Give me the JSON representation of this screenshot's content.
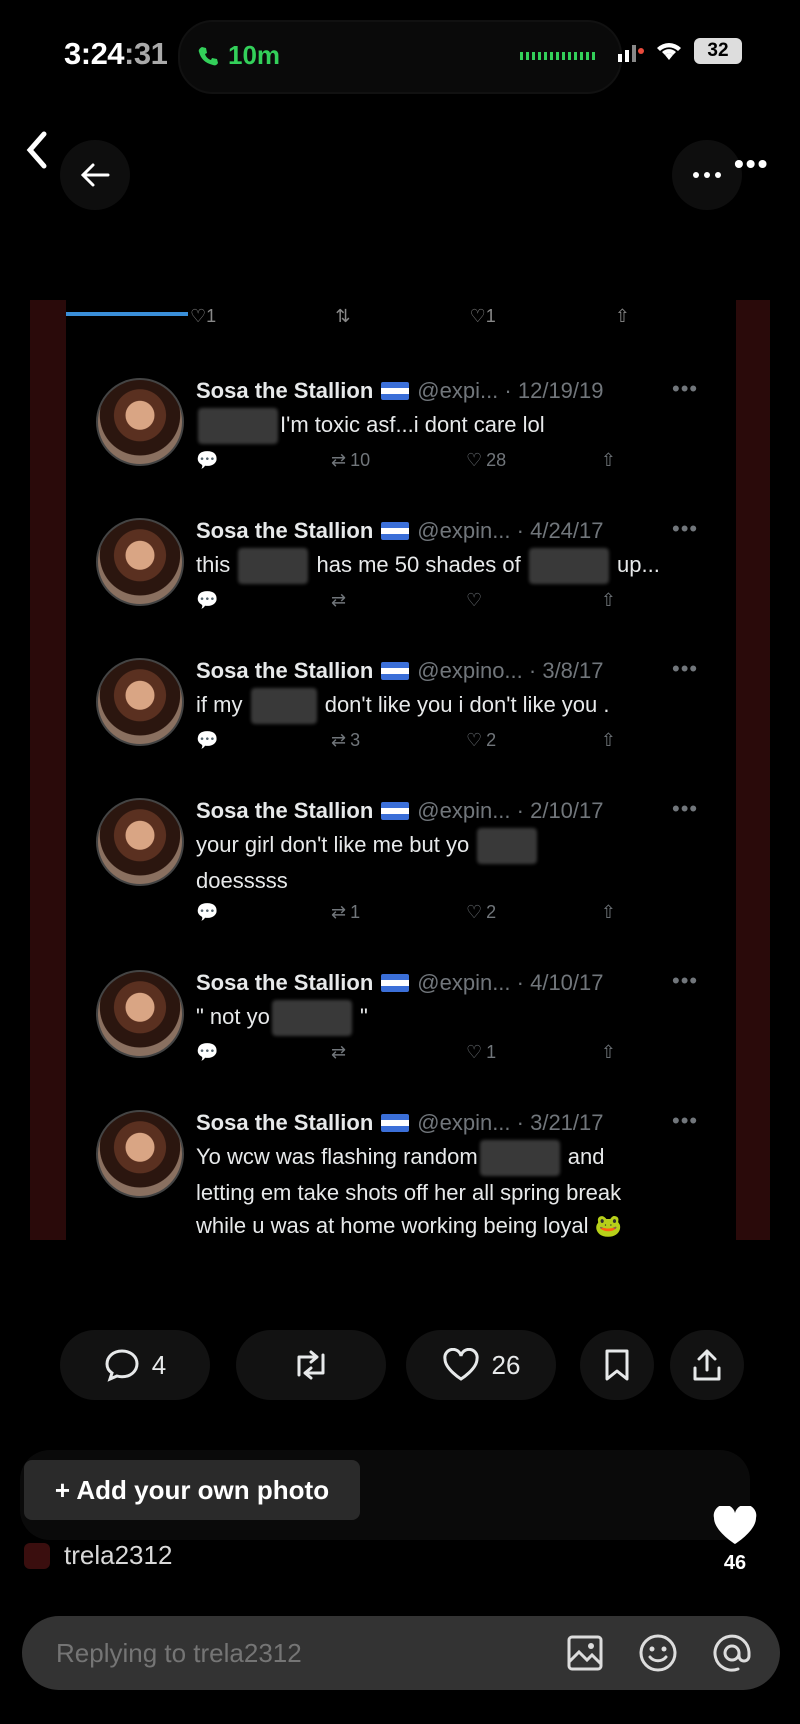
{
  "status_bar": {
    "time": "3:24",
    "seconds": ":31",
    "call_duration": "10m",
    "battery": "32"
  },
  "tweet_author": {
    "name": "Sosa the Stallion"
  },
  "tweets": [
    {
      "handle": "@expi...",
      "date": "12/19/19",
      "text_after": "I'm toxic asf...i dont care lol",
      "replies": "",
      "retweets": "10",
      "likes": "28"
    },
    {
      "handle": "@expin...",
      "date": "4/24/17",
      "text_before": "this",
      "text_middle": "has me 50 shades of",
      "text_after": "up...",
      "replies": "",
      "retweets": "",
      "likes": ""
    },
    {
      "handle": "@expino...",
      "date": "3/8/17",
      "text_before": "if my",
      "text_after": "don't like you i don't like you .",
      "replies": "",
      "retweets": "3",
      "likes": "2"
    },
    {
      "handle": "@expin...",
      "date": "2/10/17",
      "text_before": "your girl don't like me but yo",
      "text_line2": "doesssss",
      "replies": "",
      "retweets": "1",
      "likes": "2"
    },
    {
      "handle": "@expin...",
      "date": "4/10/17",
      "text_before": "\" not yo",
      "text_after": "\"",
      "replies": "",
      "retweets": "",
      "likes": "1"
    },
    {
      "handle": "@expin...",
      "date": "3/21/17",
      "text_before": "Yo wcw was flashing random",
      "text_after": "and",
      "text_line2": "letting em take shots off her all spring break",
      "text_line3": "while u was at home working being loyal 🐸",
      "replies": "",
      "retweets": "",
      "likes": ""
    }
  ],
  "cut_row": {
    "likes_a": "1",
    "likes_b": "1"
  },
  "post_actions": {
    "comments": "4",
    "likes": "26"
  },
  "story": {
    "add_photo": "+ Add your own photo",
    "username": "trela2312",
    "like_count": "46"
  },
  "reply": {
    "placeholder": "Replying to trela2312"
  },
  "icons": [
    "back-chevron-icon",
    "back-arrow-icon",
    "more-icon",
    "reply-icon",
    "retweet-icon",
    "heart-icon",
    "share-icon",
    "bookmark-icon",
    "image-icon",
    "sticker-icon",
    "mention-icon"
  ]
}
